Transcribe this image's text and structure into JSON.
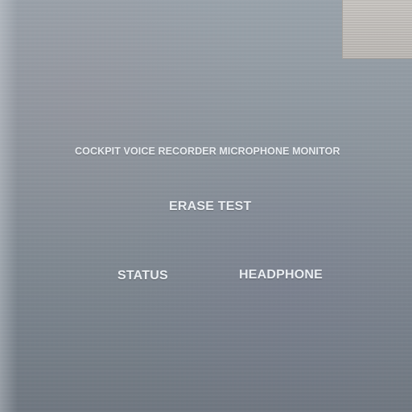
{
  "panel": {
    "title": "COCKPIT VOICE RECORDER MICROPHONE MONITOR",
    "erase_test_label": "ERASE  TEST",
    "status_label": "STATUS",
    "headphone_label": "HEADPHONE"
  },
  "colors": {
    "panel_background": "#828c96",
    "label_text": "#e9edf1",
    "thumbnail_plate": "#c9c6c2"
  }
}
